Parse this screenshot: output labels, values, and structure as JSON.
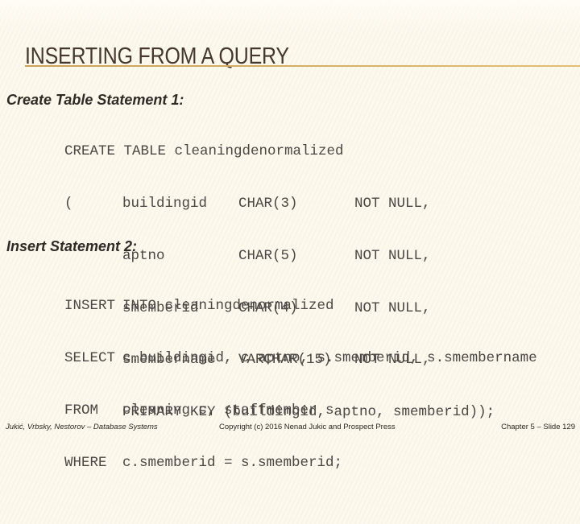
{
  "slide": {
    "title": "INSERTING FROM A QUERY",
    "accent_color": "#d4ad66",
    "background_color": "#fcf9ee"
  },
  "sections": [
    {
      "heading": "Create Table Statement 1:",
      "code_lines": [
        [
          "CREATE TABLE cleaningdenormalized",
          "",
          "",
          ""
        ],
        [
          "(",
          "buildingid",
          "CHAR(3)",
          "NOT NULL,"
        ],
        [
          "",
          "aptno",
          "CHAR(5)",
          "NOT NULL,"
        ],
        [
          "",
          "smemberid",
          "CHAR(4)",
          "NOT NULL,"
        ],
        [
          "",
          "smembername",
          "VARCHAR(15)",
          "NOT NULL,"
        ],
        [
          "",
          "PRIMARY KEY (buildingid, aptno, smemberid));",
          "",
          ""
        ]
      ]
    },
    {
      "heading": "Insert Statement 2:",
      "code_lines": [
        [
          "INSERT",
          "INTO cleaningdenormalized"
        ],
        [
          "SELECT",
          "c.buildingid, c.aptno, s.smemberid, s.smembername"
        ],
        [
          "FROM",
          "cleaning c, staffmember s"
        ],
        [
          "WHERE",
          "c.smemberid = s.smemberid;"
        ]
      ]
    }
  ],
  "footer": {
    "left": "Jukić, Vrbsky, Nestorov – Database Systems",
    "center": "Copyright (c) 2016 Nenad Jukic and Prospect Press",
    "right": "Chapter 5 – Slide 129"
  }
}
